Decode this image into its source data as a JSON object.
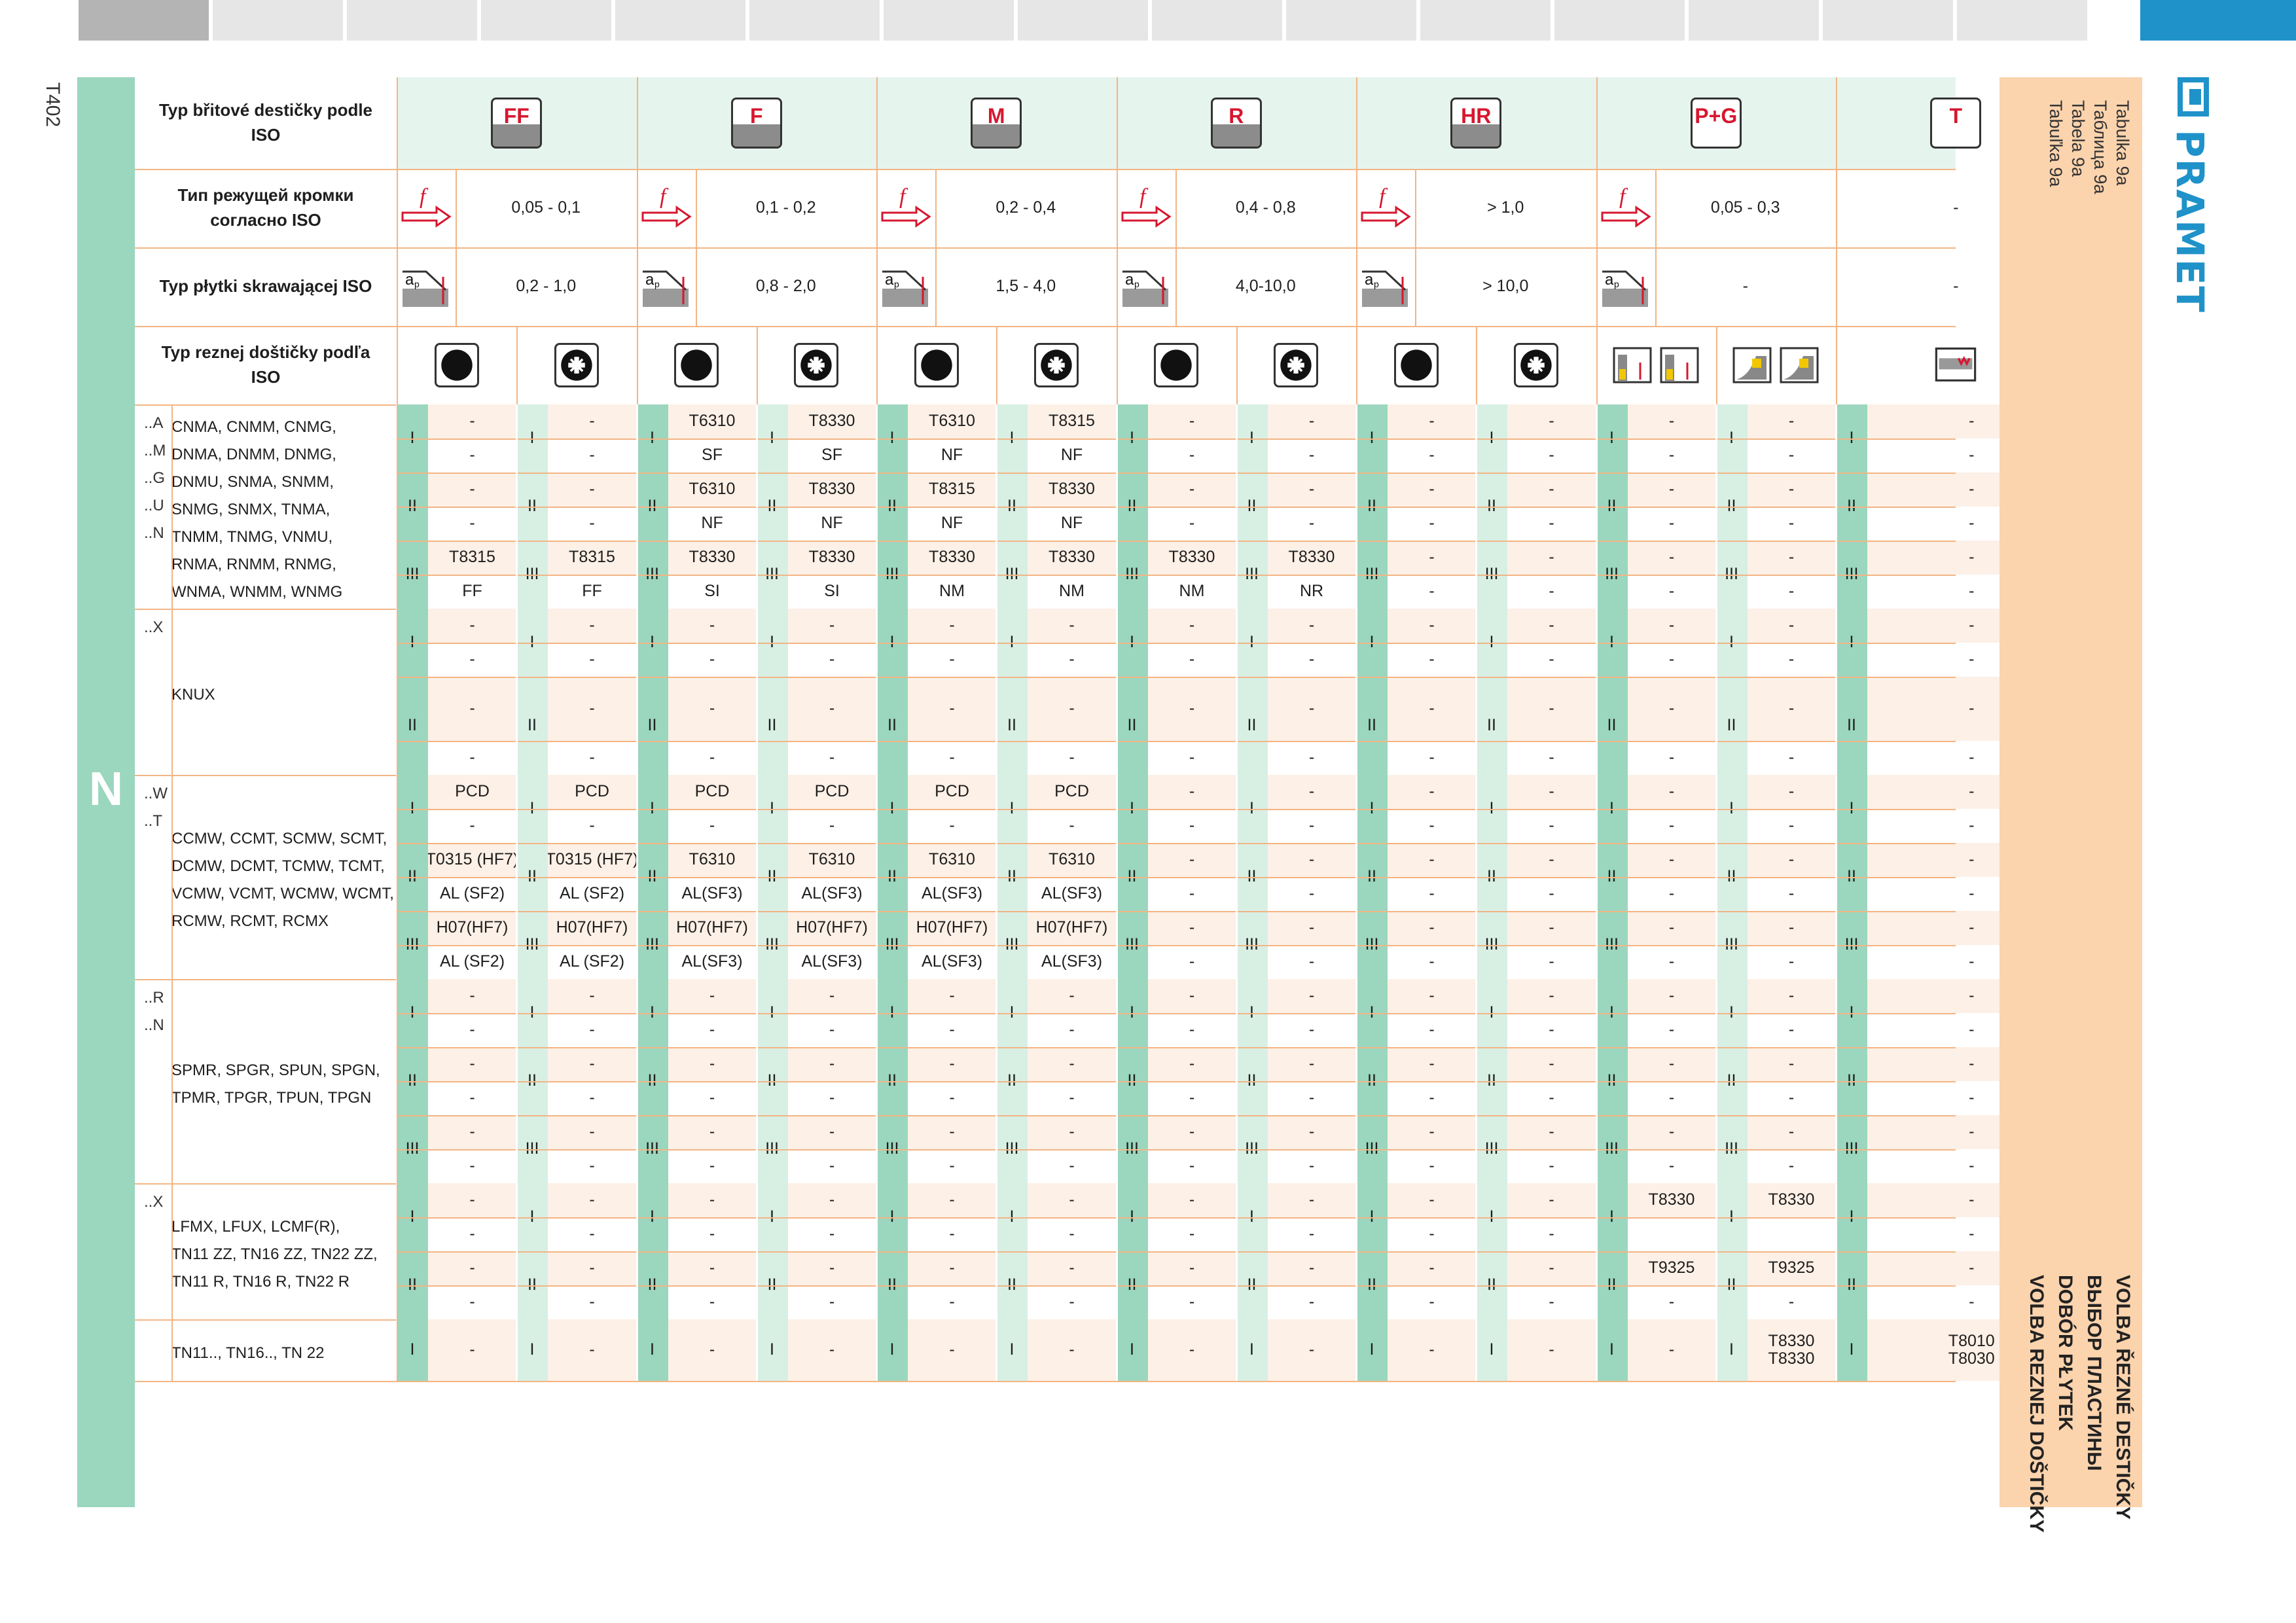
{
  "page_code": "T402",
  "section_letter": "N",
  "side_panel": {
    "table_labels": [
      "Tabulka 9a",
      "Таблица 9a",
      "Tabela 9a",
      "Tabuľka 9a"
    ],
    "titles": [
      "VOLBA ŘEZNÉ DESTIČKY",
      "ВЫБОР ПЛАСТИНЫ",
      "DOBÓR PŁYTEK",
      "VOLBA REZNEJ DOŠTIČKY"
    ]
  },
  "brand": "PRAMET",
  "colors": {
    "accent_blue": "#1f92c9",
    "green": "#9bd6be",
    "peach": "#fbd3ad",
    "red": "#d7172f"
  },
  "header": {
    "row_labels": [
      "Typ břitové destičky podle ISO",
      "Тип режущей кромки согласно ISO",
      "Typ płytki skrawającej ISO",
      "Typ reznej doštičky podľa ISO"
    ],
    "groups": [
      "FF",
      "F",
      "M",
      "R",
      "HR",
      "P+G",
      "T"
    ],
    "feed_symbol": "f",
    "depth_symbol": "ap",
    "feed": [
      "0,05 - 0,1",
      "0,1 - 0,2",
      "0,2 - 0,4",
      "0,4 - 0,8",
      "> 1,0",
      "0,05 - 0,3",
      "-"
    ],
    "depth": [
      "0,2 - 1,0",
      "0,8  - 2,0",
      "1,5 - 4,0",
      "4,0-10,0",
      "> 10,0",
      "-",
      "-"
    ],
    "cond_icons": [
      "continuous-cut-icon",
      "interrupted-cut-icon",
      "continuous-cut-icon",
      "interrupted-cut-icon",
      "continuous-cut-icon",
      "interrupted-cut-icon",
      "continuous-cut-icon",
      "interrupted-cut-icon",
      "continuous-cut-icon",
      "interrupted-cut-icon",
      "grooving-icon",
      "profiling-icon",
      "threading-icon"
    ]
  },
  "groups": [
    {
      "codes": [
        "..A",
        "..M",
        "..G",
        "..U",
        "..N"
      ],
      "inserts": [
        "CNMA,   CNMM,   CNMG,",
        "DNMA,   DNMM,   DNMG,",
        "DNMU,   SNMA,   SNMM,",
        "SNMG,   SNMX,   TNMA,",
        "TNMM,   TNMG,   VNMU,",
        "RNMA,   RNMM,   RNMG,",
        "WNMA,  WNMM,  WNMG"
      ],
      "rows": [
        {
          "roman": "I",
          "height": 52,
          "values": [
            "-",
            "-",
            "T6310",
            "T8330",
            "T6310",
            "T8315",
            "-",
            "-",
            "-",
            "-",
            "-",
            "-",
            "-"
          ]
        },
        {
          "roman": "",
          "height": 52,
          "values": [
            "-",
            "-",
            "SF",
            "SF",
            "NF",
            "NF",
            "-",
            "-",
            "-",
            "-",
            "-",
            "-",
            "-"
          ]
        },
        {
          "roman": "II",
          "height": 52,
          "values": [
            "-",
            "-",
            "T6310",
            "T8330",
            "T8315",
            "T8330",
            "-",
            "-",
            "-",
            "-",
            "-",
            "-",
            "-"
          ]
        },
        {
          "roman": "",
          "height": 52,
          "values": [
            "-",
            "-",
            "NF",
            "NF",
            "NF",
            "NF",
            "-",
            "-",
            "-",
            "-",
            "-",
            "-",
            "-"
          ]
        },
        {
          "roman": "III",
          "height": 52,
          "values": [
            "T8315",
            "T8315",
            "T8330",
            "T8330",
            "T8330",
            "T8330",
            "T8330",
            "T8330",
            "-",
            "-",
            "-",
            "-",
            "-"
          ]
        },
        {
          "roman": "",
          "height": 52,
          "values": [
            "FF",
            "FF",
            "SI",
            "SI",
            "NM",
            "NM",
            "NM",
            "NR",
            "-",
            "-",
            "-",
            "-",
            "-"
          ]
        }
      ]
    },
    {
      "codes": [
        "..X"
      ],
      "inserts": [
        "KNUX"
      ],
      "rows": [
        {
          "roman": "I",
          "height": 52,
          "values": [
            "-",
            "-",
            "-",
            "-",
            "-",
            "-",
            "-",
            "-",
            "-",
            "-",
            "-",
            "-",
            "-"
          ]
        },
        {
          "roman": "",
          "height": 52,
          "values": [
            "-",
            "-",
            "-",
            "-",
            "-",
            "-",
            "-",
            "-",
            "-",
            "-",
            "-",
            "-",
            "-"
          ]
        },
        {
          "roman": "II",
          "height": 98,
          "values": [
            "-",
            "-",
            "-",
            "-",
            "-",
            "-",
            "-",
            "-",
            "-",
            "-",
            "-",
            "-",
            "-"
          ]
        },
        {
          "roman": "",
          "height": 52,
          "values": [
            "-",
            "-",
            "-",
            "-",
            "-",
            "-",
            "-",
            "-",
            "-",
            "-",
            "-",
            "-",
            "-"
          ]
        }
      ]
    },
    {
      "codes": [
        "..W",
        "..T"
      ],
      "inserts": [
        "CCMW, CCMT, SCMW, SCMT,",
        "DCMW,  DCMT, TCMW,  TCMT,",
        "VCMW, VCMT, WCMW,  WCMT,",
        "RCMW,  RCMT,  RCMX"
      ],
      "rows": [
        {
          "roman": "I",
          "height": 52,
          "values": [
            "PCD",
            "PCD",
            "PCD",
            "PCD",
            "PCD",
            "PCD",
            "-",
            "-",
            "-",
            "-",
            "-",
            "-",
            "-"
          ]
        },
        {
          "roman": "",
          "height": 52,
          "values": [
            "-",
            "-",
            "-",
            "-",
            "-",
            "-",
            "-",
            "-",
            "-",
            "-",
            "-",
            "-",
            "-"
          ]
        },
        {
          "roman": "II",
          "height": 52,
          "values": [
            "T0315 (HF7)",
            "T0315 (HF7)",
            "T6310",
            "T6310",
            "T6310",
            "T6310",
            "-",
            "-",
            "-",
            "-",
            "-",
            "-",
            "-"
          ]
        },
        {
          "roman": "",
          "height": 52,
          "values": [
            "AL (SF2)",
            "AL (SF2)",
            "AL(SF3)",
            "AL(SF3)",
            "AL(SF3)",
            "AL(SF3)",
            "-",
            "-",
            "-",
            "-",
            "-",
            "-",
            "-"
          ]
        },
        {
          "roman": "III",
          "height": 52,
          "values": [
            "H07(HF7)",
            "H07(HF7)",
            "H07(HF7)",
            "H07(HF7)",
            "H07(HF7)",
            "H07(HF7)",
            "-",
            "-",
            "-",
            "-",
            "-",
            "-",
            "-"
          ]
        },
        {
          "roman": "",
          "height": 52,
          "values": [
            "AL (SF2)",
            "AL (SF2)",
            "AL(SF3)",
            "AL(SF3)",
            "AL(SF3)",
            "AL(SF3)",
            "-",
            "-",
            "-",
            "-",
            "-",
            "-",
            "-"
          ]
        }
      ]
    },
    {
      "codes": [
        "..R",
        "..N"
      ],
      "inserts": [
        "SPMR, SPGR, SPUN, SPGN,",
        "TPMR, TPGR, TPUN, TPGN"
      ],
      "rows": [
        {
          "roman": "I",
          "height": 52,
          "values": [
            "-",
            "-",
            "-",
            "-",
            "-",
            "-",
            "-",
            "-",
            "-",
            "-",
            "-",
            "-",
            "-"
          ]
        },
        {
          "roman": "",
          "height": 52,
          "values": [
            "-",
            "-",
            "-",
            "-",
            "-",
            "-",
            "-",
            "-",
            "-",
            "-",
            "-",
            "-",
            "-"
          ]
        },
        {
          "roman": "II",
          "height": 52,
          "values": [
            "-",
            "-",
            "-",
            "-",
            "-",
            "-",
            "-",
            "-",
            "-",
            "-",
            "-",
            "-",
            "-"
          ]
        },
        {
          "roman": "",
          "height": 52,
          "values": [
            "-",
            "-",
            "-",
            "-",
            "-",
            "-",
            "-",
            "-",
            "-",
            "-",
            "-",
            "-",
            "-"
          ]
        },
        {
          "roman": "III",
          "height": 52,
          "values": [
            "-",
            "-",
            "-",
            "-",
            "-",
            "-",
            "-",
            "-",
            "-",
            "-",
            "-",
            "-",
            "-"
          ]
        },
        {
          "roman": "",
          "height": 52,
          "values": [
            "-",
            "-",
            "-",
            "-",
            "-",
            "-",
            "-",
            "-",
            "-",
            "-",
            "-",
            "-",
            "-"
          ]
        }
      ]
    },
    {
      "codes": [
        "..X"
      ],
      "inserts": [
        "LFMX, LFUX, LCMF(R),",
        "TN11 ZZ, TN16 ZZ, TN22 ZZ,",
        "TN11 R, TN16 R, TN22 R"
      ],
      "rows": [
        {
          "roman": "I",
          "height": 52,
          "values": [
            "-",
            "-",
            "-",
            "-",
            "-",
            "-",
            "-",
            "-",
            "-",
            "-",
            "T8330",
            "T8330",
            "-"
          ]
        },
        {
          "roman": "",
          "height": 52,
          "values": [
            "-",
            "-",
            "-",
            "-",
            "-",
            "-",
            "-",
            "-",
            "-",
            "-",
            "",
            "",
            "-"
          ]
        },
        {
          "roman": "II",
          "height": 52,
          "values": [
            "-",
            "-",
            "-",
            "-",
            "-",
            "-",
            "-",
            "-",
            "-",
            "-",
            "T9325",
            "T9325",
            "-"
          ]
        },
        {
          "roman": "",
          "height": 52,
          "values": [
            "-",
            "-",
            "-",
            "-",
            "-",
            "-",
            "-",
            "-",
            "-",
            "-",
            "-",
            "-",
            "-"
          ]
        }
      ]
    },
    {
      "codes": [
        ""
      ],
      "inserts": [
        "TN11.., TN16.., TN 22"
      ],
      "rows": [
        {
          "roman": "I",
          "height": 94,
          "values": [
            "-",
            "-",
            "-",
            "-",
            "-",
            "-",
            "-",
            "-",
            "-",
            "-",
            "-",
            "T8330\nT8330",
            "T8010\nT8030"
          ]
        }
      ]
    }
  ]
}
